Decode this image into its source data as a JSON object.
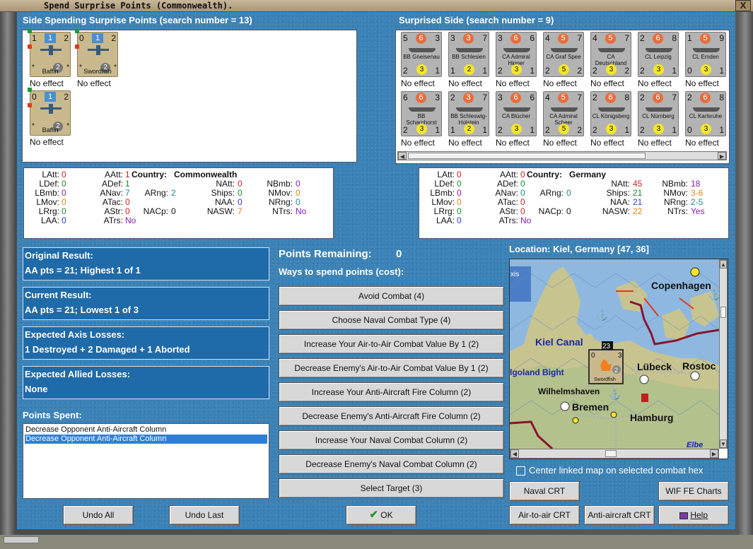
{
  "window": {
    "title": "Spend Surprise Points (Commonwealth).",
    "close": "X"
  },
  "left_header": "Side Spending Surprise Points (search number = 13)",
  "right_header": "Surprised Side (search number = 9)",
  "spending_units": [
    {
      "tl": "1",
      "mid": "1",
      "tr": "2",
      "circle": "2",
      "name": "Baffin",
      "effect": "No effect"
    },
    {
      "tl": "0",
      "mid": "1",
      "tr": "2",
      "circle": "2",
      "name": "Swordfish",
      "effect": "No effect"
    },
    {
      "tl": "0",
      "mid": "1",
      "tr": "2",
      "circle": "2",
      "name": "Baffin",
      "effect": "No effect"
    }
  ],
  "surprised_units": [
    {
      "tl": "5",
      "mid": "6",
      "tr": "3",
      "bl": "2",
      "circle": "3",
      "br": "1",
      "name": "BB Gneisenau",
      "effect": "No effect"
    },
    {
      "tl": "3",
      "mid": "3",
      "tr": "7",
      "bl": "1",
      "circle": "2",
      "br": "1",
      "name": "BB Schlesien",
      "effect": "No effect"
    },
    {
      "tl": "3",
      "mid": "6",
      "tr": "6",
      "bl": "2",
      "circle": "3",
      "br": "1",
      "name": "CA Admiral Hipper",
      "effect": "No effect"
    },
    {
      "tl": "4",
      "mid": "5",
      "tr": "7",
      "bl": "2",
      "circle": "5",
      "br": "2",
      "name": "CA Graf Spee",
      "effect": "No effect"
    },
    {
      "tl": "4",
      "mid": "5",
      "tr": "7",
      "bl": "2",
      "circle": "3",
      "br": "2",
      "name": "CA Deutschland",
      "effect": "No effect"
    },
    {
      "tl": "2",
      "mid": "6",
      "tr": "8",
      "bl": "2",
      "circle": "3",
      "br": "1",
      "name": "CL Leipzig",
      "effect": "No effect"
    },
    {
      "tl": "1",
      "mid": "5",
      "tr": "9",
      "bl": "0",
      "circle": "3",
      "br": "1",
      "name": "CL Emden",
      "effect": "No effect"
    },
    {
      "tl": "6",
      "mid": "6",
      "tr": "3",
      "bl": "2",
      "circle": "3",
      "br": "1",
      "name": "BB Scharnhorst",
      "effect": "No effect"
    },
    {
      "tl": "2",
      "mid": "3",
      "tr": "7",
      "bl": "1",
      "circle": "2",
      "br": "1",
      "name": "BB Schleswig-Holstein",
      "effect": "No effect"
    },
    {
      "tl": "3",
      "mid": "6",
      "tr": "6",
      "bl": "2",
      "circle": "3",
      "br": "1",
      "name": "CA Blücher",
      "effect": "No effect"
    },
    {
      "tl": "4",
      "mid": "5",
      "tr": "7",
      "bl": "2",
      "circle": "5",
      "br": "2",
      "name": "CA Admiral Scheer",
      "effect": "No effect"
    },
    {
      "tl": "2",
      "mid": "6",
      "tr": "8",
      "bl": "2",
      "circle": "3",
      "br": "1",
      "name": "CL Königsberg",
      "effect": "No effect"
    },
    {
      "tl": "2",
      "mid": "6",
      "tr": "7",
      "bl": "2",
      "circle": "3",
      "br": "1",
      "name": "CL Nürnberg",
      "effect": "No effect"
    },
    {
      "tl": "2",
      "mid": "6",
      "tr": "8",
      "bl": "0",
      "circle": "3",
      "br": "1",
      "name": "CL Karlsruhe",
      "effect": "No effect"
    }
  ],
  "left_stats": {
    "country_label": "Country:",
    "country": "Commonwealth",
    "LAtt": "0",
    "LDef": "0",
    "LBmb": "0",
    "LMov": "0",
    "LRrg": "0",
    "LAA": "0",
    "AAtt": "1",
    "ADef": "1",
    "ANav": "7",
    "ATac": "0",
    "AStr": "0",
    "ATrs": "No",
    "ARng": "2",
    "NACp": "0",
    "NAtt": "0",
    "Ships": "0",
    "NAA": "0",
    "NASW": "7",
    "NBmb": "0",
    "NMov": "0",
    "NRng": "0",
    "NTrs": "No"
  },
  "right_stats": {
    "country_label": "Country:",
    "country": "Germany",
    "LAtt": "0",
    "LDef": "0",
    "LBmb": "0",
    "LMov": "0",
    "LRrg": "0",
    "LAA": "0",
    "AAtt": "0",
    "ADef": "0",
    "ANav": "0",
    "ATac": "0",
    "AStr": "0",
    "ATrs": "No",
    "ARng": "0",
    "NACp": "0",
    "NAtt": "45",
    "Ships": "21",
    "NAA": "21",
    "NASW": "22",
    "NBmb": "18",
    "NMov": "3-6",
    "NRng": "2-5",
    "NTrs": "Yes"
  },
  "original_result": {
    "label": "Original Result:",
    "value": "AA pts = 21; Highest 1 of 1"
  },
  "current_result": {
    "label": "Current Result:",
    "value": "AA pts = 21; Lowest 1 of 3"
  },
  "axis_losses": {
    "label": "Expected Axis Losses:",
    "value": "1 Destroyed + 2 Damaged + 1 Aborted"
  },
  "allied_losses": {
    "label": "Expected Allied Losses:",
    "value": "None"
  },
  "points_spent": {
    "label": "Points Spent:",
    "items": [
      "Decrease Opponent Anti-Aircraft Column",
      "Decrease Opponent Anti-Aircraft Column"
    ]
  },
  "points_remaining": {
    "label": "Points Remaining:",
    "value": "0"
  },
  "ways_label": "Ways to spend points (cost):",
  "spend_options": [
    "Avoid Combat (4)",
    "Choose Naval Combat Type (4)",
    "Increase Your Air-to-Air Combat Value By 1 (2)",
    "Decrease Enemy's Air-to-Air Combat Value By 1 (2)",
    "Increase Your Anti-Aircraft Fire Column (2)",
    "Decrease Enemy's Anti-Aircraft Fire Column (2)",
    "Increase Your Naval Combat Column (2)",
    "Decrease Enemy's Naval Combat Column (2)",
    "Select Target (3)"
  ],
  "location": "Location: Kiel, Germany [47, 36]",
  "map_labels": {
    "copenhagen": "Copenhagen",
    "kiel_canal": "Kiel Canal",
    "lubeck": "Lübeck",
    "rostock": "Rostoc",
    "heligoland": "lgoland Bight",
    "wilhelmshaven": "Wilhelmshaven",
    "bremen": "Bremen",
    "hamburg": "Hamburg",
    "elbe": "Elbe",
    "axis": "xis",
    "stack": "23",
    "unit_tl": "0",
    "unit_tr": "3",
    "unit_circle": "2",
    "unit_name": "Swordfish"
  },
  "center_checkbox": "Center linked map on selected combat hex",
  "buttons": {
    "undo_all": "Undo All",
    "undo_last": "Undo Last",
    "ok": "OK",
    "naval_crt": "Naval CRT",
    "wif_charts": "WIF FE Charts",
    "air_crt": "Air-to-air CRT",
    "aa_crt": "Anti-aircraft CRT",
    "help": "Help"
  },
  "colors": {
    "panel": "#3b82b6",
    "info_box": "#1f6aa8",
    "red": "#d21f1f",
    "green": "#1a8a2a",
    "blue": "#2a3cc8",
    "purple": "#8a18b0",
    "teal": "#1a8a8a",
    "orange": "#d88a12"
  }
}
